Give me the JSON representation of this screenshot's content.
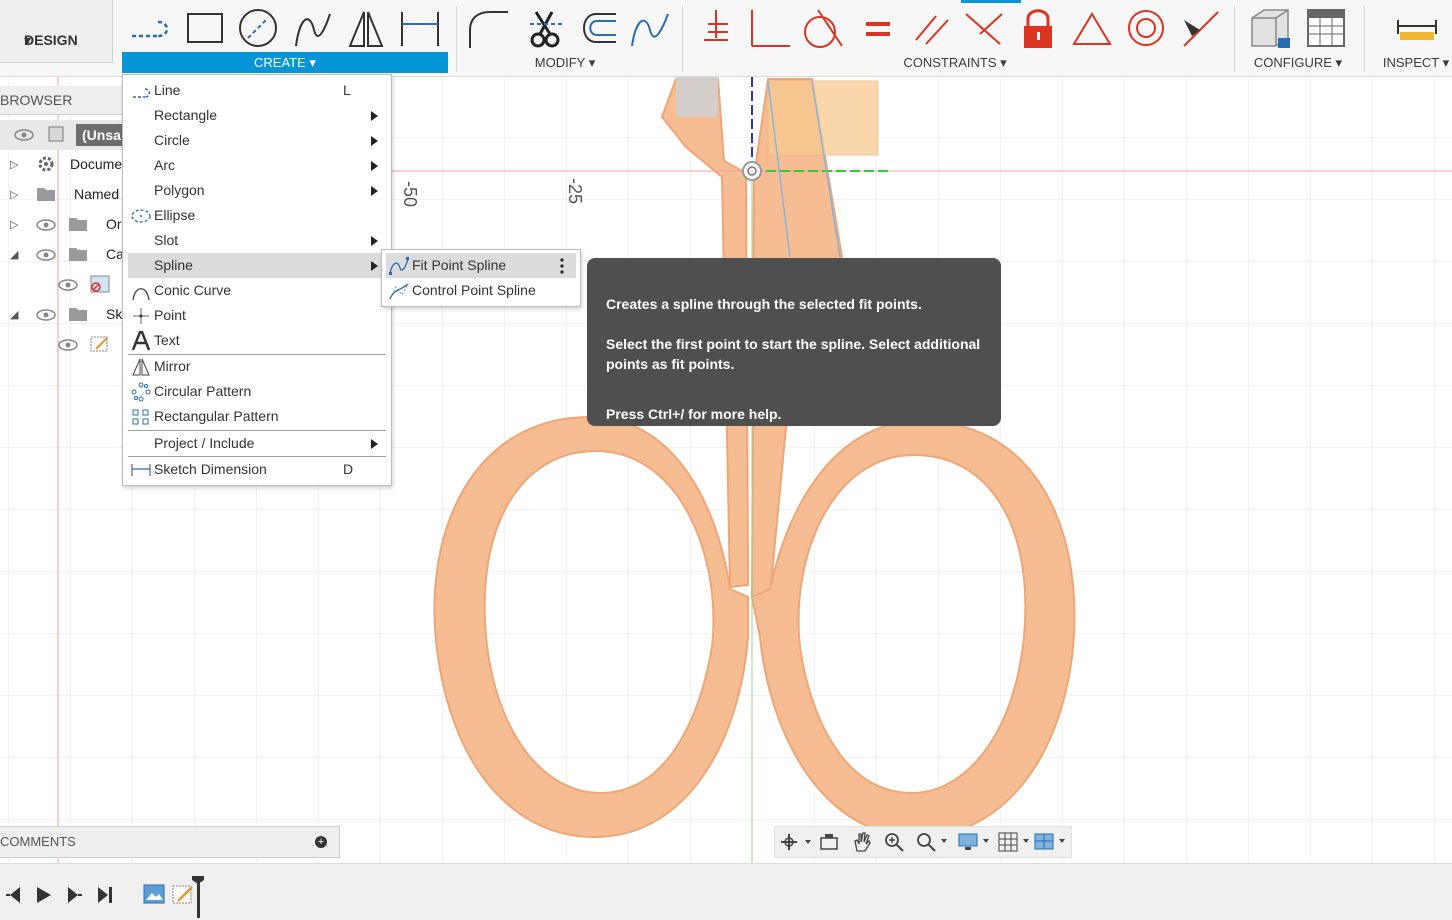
{
  "toolbar": {
    "workspace": "DESIGN",
    "groups": [
      {
        "label": "CREATE"
      },
      {
        "label": "MODIFY"
      },
      {
        "label": "CONSTRAINTS"
      },
      {
        "label": "CONFIGURE"
      },
      {
        "label": "INSPECT"
      }
    ],
    "dropdown_glyph": "▾"
  },
  "browser": {
    "header": "BROWSER",
    "rows": [
      {
        "label": "(Unsa"
      },
      {
        "label": "Docume"
      },
      {
        "label": "Named"
      },
      {
        "label": "Or"
      },
      {
        "label": "Ca"
      },
      {
        "label": ""
      },
      {
        "label": "Sk"
      },
      {
        "label": ""
      }
    ]
  },
  "canvas": {
    "ruler_labels": [
      "-50",
      "-25"
    ],
    "colors": {
      "scissors": "#f5b98b",
      "grid": "#e6e6e6",
      "axis_red": "#e86c6c",
      "axis_green": "#44bb44"
    }
  },
  "create_menu": {
    "items": [
      {
        "label": "Line",
        "shortcut": "L",
        "icon": "line-icon"
      },
      {
        "label": "Rectangle",
        "submenu": true
      },
      {
        "label": "Circle",
        "submenu": true
      },
      {
        "label": "Arc",
        "submenu": true
      },
      {
        "label": "Polygon",
        "submenu": true
      },
      {
        "label": "Ellipse",
        "icon": "ellipse-icon"
      },
      {
        "label": "Slot",
        "submenu": true
      },
      {
        "label": "Spline",
        "submenu": true,
        "highlighted": true
      },
      {
        "label": "Conic Curve",
        "icon": "conic-curve-icon"
      },
      {
        "label": "Point",
        "icon": "point-icon"
      },
      {
        "label": "Text",
        "icon": "text-icon"
      },
      {
        "label": "Mirror",
        "icon": "mirror-icon"
      },
      {
        "label": "Circular Pattern",
        "icon": "circular-pattern-icon"
      },
      {
        "label": "Rectangular Pattern",
        "icon": "rectangular-pattern-icon"
      },
      {
        "label": "Project / Include",
        "submenu": true
      },
      {
        "label": "Sketch Dimension",
        "shortcut": "D",
        "icon": "sketch-dimension-icon"
      }
    ]
  },
  "spline_submenu": {
    "items": [
      {
        "label": "Fit Point Spline",
        "highlighted": true
      },
      {
        "label": "Control Point Spline"
      }
    ]
  },
  "tooltip": {
    "line1": "Creates a spline through the selected fit points.",
    "line2": "Select the first point to start the spline. Select additional points as fit points.",
    "line3": "Press Ctrl+/ for more help."
  },
  "comments": {
    "header": "COMMENTS"
  }
}
